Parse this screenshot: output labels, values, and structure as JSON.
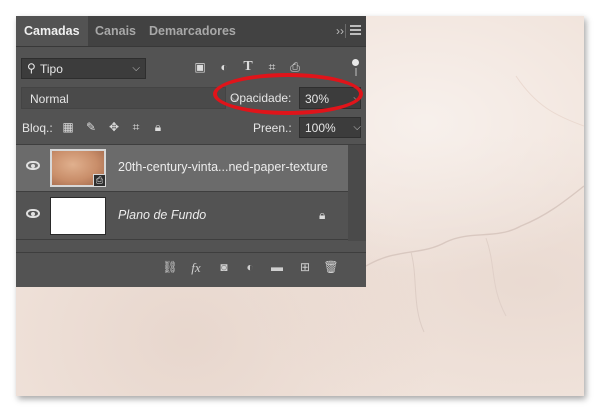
{
  "tabs": [
    {
      "label": "Camadas",
      "active": true
    },
    {
      "label": "Canais",
      "active": false
    },
    {
      "label": "Demarcadores",
      "active": false
    }
  ],
  "tab_collapse": "››",
  "filter": {
    "label": "Tipo",
    "icon": "search-icon"
  },
  "filter_icons": [
    "image-filter-icon",
    "adjustment-filter-icon",
    "type-filter-icon",
    "shape-filter-icon",
    "smart-object-filter-icon"
  ],
  "blend_mode": "Normal",
  "opacity": {
    "label": "Opacidade:",
    "value": "30%"
  },
  "lock": {
    "label": "Bloq.:",
    "icons": [
      "lock-transparent-icon",
      "lock-paint-icon",
      "lock-move-icon",
      "lock-artboard-icon",
      "lock-all-icon"
    ]
  },
  "fill": {
    "label": "Preen.:",
    "value": "100%"
  },
  "layers": [
    {
      "name": "20th-century-vinta...ned-paper-texture",
      "selected": true,
      "italic": false,
      "thumb_color": "#c98e6a"
    },
    {
      "name": "Plano de Fundo",
      "selected": false,
      "italic": true,
      "locked": true,
      "thumb_color": "#ffffff"
    }
  ],
  "bottom_icons": [
    "link-layers-icon",
    "fx-icon",
    "mask-icon",
    "adjustment-icon",
    "folder-icon",
    "new-layer-icon",
    "trash-icon"
  ],
  "colors": {
    "panel": "#535353",
    "highlight": "#e0141a",
    "background": "#f1e4dc"
  }
}
